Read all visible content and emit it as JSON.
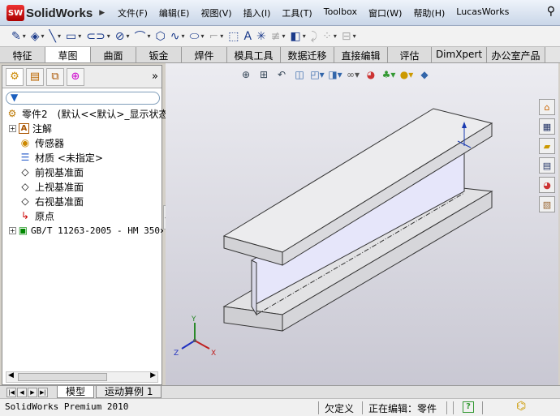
{
  "app": {
    "logo_badge": "SW",
    "logo_text": "SolidWorks"
  },
  "menu": [
    "文件(F)",
    "编辑(E)",
    "视图(V)",
    "插入(I)",
    "工具(T)",
    "Toolbox",
    "窗口(W)",
    "帮助(H)",
    "LucasWorks"
  ],
  "command_tabs": [
    "特征",
    "草图",
    "曲面",
    "钣金",
    "焊件",
    "模具工具",
    "数据迁移",
    "直接编辑",
    "评估",
    "DimXpert",
    "办公室产品"
  ],
  "active_tab": "草图",
  "feature_tree": {
    "root": "零件2　(默认<<默认>_显示状态",
    "items": [
      {
        "label": "注解",
        "icon": "annotation-icon",
        "expandable": true
      },
      {
        "label": "传感器",
        "icon": "sensor-icon",
        "expandable": false
      },
      {
        "label": "材质 <未指定>",
        "icon": "material-icon",
        "expandable": false
      },
      {
        "label": "前视基准面",
        "icon": "plane-icon",
        "expandable": false
      },
      {
        "label": "上视基准面",
        "icon": "plane-icon",
        "expandable": false
      },
      {
        "label": "右视基准面",
        "icon": "plane-icon",
        "expandable": false
      },
      {
        "label": "原点",
        "icon": "origin-icon",
        "expandable": false
      },
      {
        "label": "GB/T 11263-2005 - HM 350×",
        "icon": "part-feature-icon",
        "expandable": true
      }
    ]
  },
  "bottom_tabs": [
    "模型",
    "运动算例 1"
  ],
  "status": {
    "product": "SolidWorks Premium 2010",
    "state": "欠定义",
    "editing": "正在编辑：零件"
  },
  "triad": {
    "x": "X",
    "y": "Y",
    "z": "Z"
  },
  "colors": {
    "viewport_top": "#ececf1",
    "viewport_bottom": "#c9c8d3",
    "beam_face": "#e8e8ea",
    "web_face": "#e0e0f8"
  }
}
